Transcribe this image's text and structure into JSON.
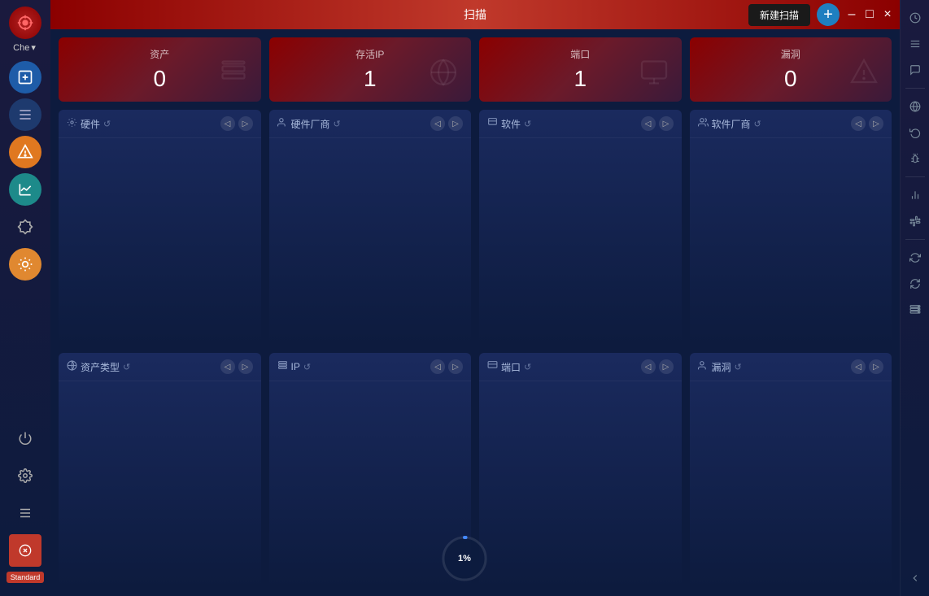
{
  "app": {
    "title": "扫描",
    "logo_icon": "⊙",
    "user_label": "Che",
    "new_scan_label": "新建扫描",
    "add_icon": "+"
  },
  "titlebar": {
    "minimize": "—",
    "maximize": "□",
    "close": "×"
  },
  "stats": [
    {
      "label": "资产",
      "value": "0",
      "icon": "⊞"
    },
    {
      "label": "存活IP",
      "value": "1",
      "icon": "⊙"
    },
    {
      "label": "端口",
      "value": "1",
      "icon": "⊟"
    },
    {
      "label": "漏洞",
      "value": "0",
      "icon": "⚠"
    }
  ],
  "top_panels": [
    {
      "title": "硬件",
      "icon": "⚙"
    },
    {
      "title": "硬件厂商",
      "icon": "👤"
    },
    {
      "title": "软件",
      "icon": "▣"
    },
    {
      "title": "软件厂商",
      "icon": "👤"
    }
  ],
  "bottom_panels": [
    {
      "title": "资产类型",
      "icon": "⊙"
    },
    {
      "title": "IP",
      "icon": "▣"
    },
    {
      "title": "端口",
      "icon": "▣"
    },
    {
      "title": "漏洞",
      "icon": "👤"
    }
  ],
  "sidebar": {
    "items": [
      {
        "label": "scan",
        "icon": "📡",
        "type": "highlight-blue"
      },
      {
        "label": "list",
        "icon": "☰",
        "type": "active"
      },
      {
        "label": "alert",
        "icon": "⚠",
        "type": "highlight-orange"
      },
      {
        "label": "chart",
        "icon": "📈",
        "type": "highlight-teal"
      },
      {
        "label": "plugin",
        "icon": "🧩",
        "type": ""
      },
      {
        "label": "ai",
        "icon": "🤖",
        "type": "highlight-ai"
      }
    ],
    "bottom_items": [
      {
        "label": "power",
        "icon": "⏻"
      },
      {
        "label": "settings",
        "icon": "⚙"
      },
      {
        "label": "menu",
        "icon": "☰"
      }
    ],
    "tag": "Standard"
  },
  "right_sidebar": {
    "items": [
      {
        "name": "clock-icon",
        "icon": "🕐"
      },
      {
        "name": "list-icon",
        "icon": "☰"
      },
      {
        "name": "chat-icon",
        "icon": "💬"
      },
      {
        "name": "ip-icon",
        "icon": "🌐"
      },
      {
        "name": "scan2-icon",
        "icon": "⟳"
      },
      {
        "name": "bug-icon",
        "icon": "🐛"
      },
      {
        "name": "bar-icon",
        "icon": "📊"
      },
      {
        "name": "plugin2-icon",
        "icon": "🧩"
      },
      {
        "name": "refresh-icon",
        "icon": "↺"
      },
      {
        "name": "sync-icon",
        "icon": "⇄"
      },
      {
        "name": "storage-icon",
        "icon": "💾"
      }
    ]
  },
  "progress": {
    "value": 1,
    "label": "1%",
    "radius": 26,
    "circumference": 163.4
  }
}
